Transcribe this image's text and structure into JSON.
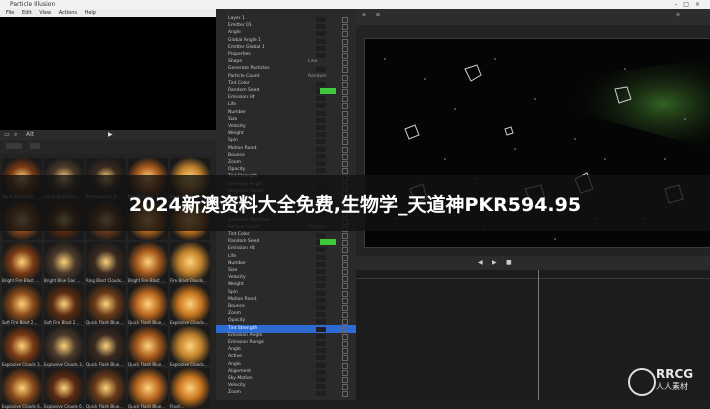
{
  "window": {
    "title": "Particle Illusion"
  },
  "menu": [
    "File",
    "Edit",
    "View",
    "Actions",
    "Help"
  ],
  "browser": {
    "tabs_label": "Alt",
    "emitters": [
      "Aerial Explosion ...",
      "Aerial Explosion ...",
      "Bellexplosion 2...",
      "Bellexplosion 2...",
      "Boom Flash Blue...",
      "",
      "",
      "",
      "",
      "",
      "Bright Fire Blast ...",
      "Bright Blue Gas ...",
      "Ring Blast Clouds...",
      "Bright Fire Blast ...",
      "Fire Blast Clouds...",
      "Soft Fire Blast 2...",
      "Soft Fire Blast 2...",
      "Quick Flash Blue...",
      "Quick Flash Blue...",
      "Explosive Clouds...",
      "Explosive Clouds 3...",
      "Explosive Clouds 3...",
      "Quick Flash Blue...",
      "Quick Flash Blue...",
      "Explosive Clouds...",
      "Explosive Clouds 6...",
      "Explosive Clouds 6...",
      "Quick Flash Blue...",
      "Quick Flash Blue...",
      "Flash..."
    ]
  },
  "properties": {
    "rows": [
      {
        "name": "Layer 1",
        "value": ""
      },
      {
        "name": "Emitter 01",
        "value": ""
      },
      {
        "name": "Angle",
        "value": ""
      },
      {
        "name": "Global Angle 1",
        "value": ""
      },
      {
        "name": "Emitter Global 1",
        "value": ""
      },
      {
        "name": "Properties",
        "value": ""
      },
      {
        "name": "Shape",
        "value": "Line"
      },
      {
        "name": "Generate Particles",
        "value": ""
      },
      {
        "name": "Particle Count",
        "value": "Random"
      },
      {
        "name": "Tint Color",
        "value": ""
      },
      {
        "name": "Random Seed",
        "value": ""
      },
      {
        "name": "Emission Ht",
        "value": ""
      },
      {
        "name": "Life",
        "value": ""
      },
      {
        "name": "Number",
        "value": ""
      },
      {
        "name": "Size",
        "value": ""
      },
      {
        "name": "Velocity",
        "value": ""
      },
      {
        "name": "Weight",
        "value": ""
      },
      {
        "name": "Spin",
        "value": ""
      },
      {
        "name": "Motion Rand.",
        "value": ""
      },
      {
        "name": "Bounce",
        "value": ""
      },
      {
        "name": "Zoom",
        "value": ""
      },
      {
        "name": "Opacity",
        "value": ""
      },
      {
        "name": "Tint Strength",
        "value": ""
      },
      {
        "name": "Emission Angle",
        "value": ""
      },
      {
        "name": "Emission Range",
        "value": ""
      },
      {
        "name": "Particle 1",
        "value": ""
      },
      {
        "name": "Properties",
        "value": ""
      },
      {
        "name": "Shape",
        "value": ""
      },
      {
        "name": "Generate Particles",
        "value": ""
      },
      {
        "name": "Particle Count",
        "value": "Random"
      },
      {
        "name": "Tint Color",
        "value": ""
      },
      {
        "name": "Random Seed",
        "value": ""
      },
      {
        "name": "Emission Ht",
        "value": ""
      },
      {
        "name": "Life",
        "value": ""
      },
      {
        "name": "Number",
        "value": ""
      },
      {
        "name": "Size",
        "value": ""
      },
      {
        "name": "Velocity",
        "value": ""
      },
      {
        "name": "Weight",
        "value": ""
      },
      {
        "name": "Spin",
        "value": ""
      },
      {
        "name": "Motion Rand.",
        "value": ""
      },
      {
        "name": "Bounce",
        "value": ""
      },
      {
        "name": "Zoom",
        "value": ""
      },
      {
        "name": "Opacity",
        "value": ""
      },
      {
        "name": "Tint Strength",
        "value": ""
      },
      {
        "name": "Emission Angle",
        "value": ""
      },
      {
        "name": "Emission Range",
        "value": ""
      },
      {
        "name": "Angle",
        "value": ""
      },
      {
        "name": "Active",
        "value": ""
      },
      {
        "name": "Angle",
        "value": ""
      },
      {
        "name": "Alignment",
        "value": ""
      },
      {
        "name": "Sky Motion",
        "value": ""
      },
      {
        "name": "Velocity",
        "value": ""
      },
      {
        "name": "Zoom",
        "value": ""
      }
    ],
    "selected_index": 43
  },
  "banner": {
    "text": "2024新澳资料大全免费,生物学_天道神PKR594.95"
  },
  "watermark": {
    "brand": "RRCG",
    "sub": "人人素材"
  },
  "colors": {
    "accent_blue": "#2d6bd3",
    "green": "#3ec83e",
    "panel": "#2a2a2a"
  }
}
